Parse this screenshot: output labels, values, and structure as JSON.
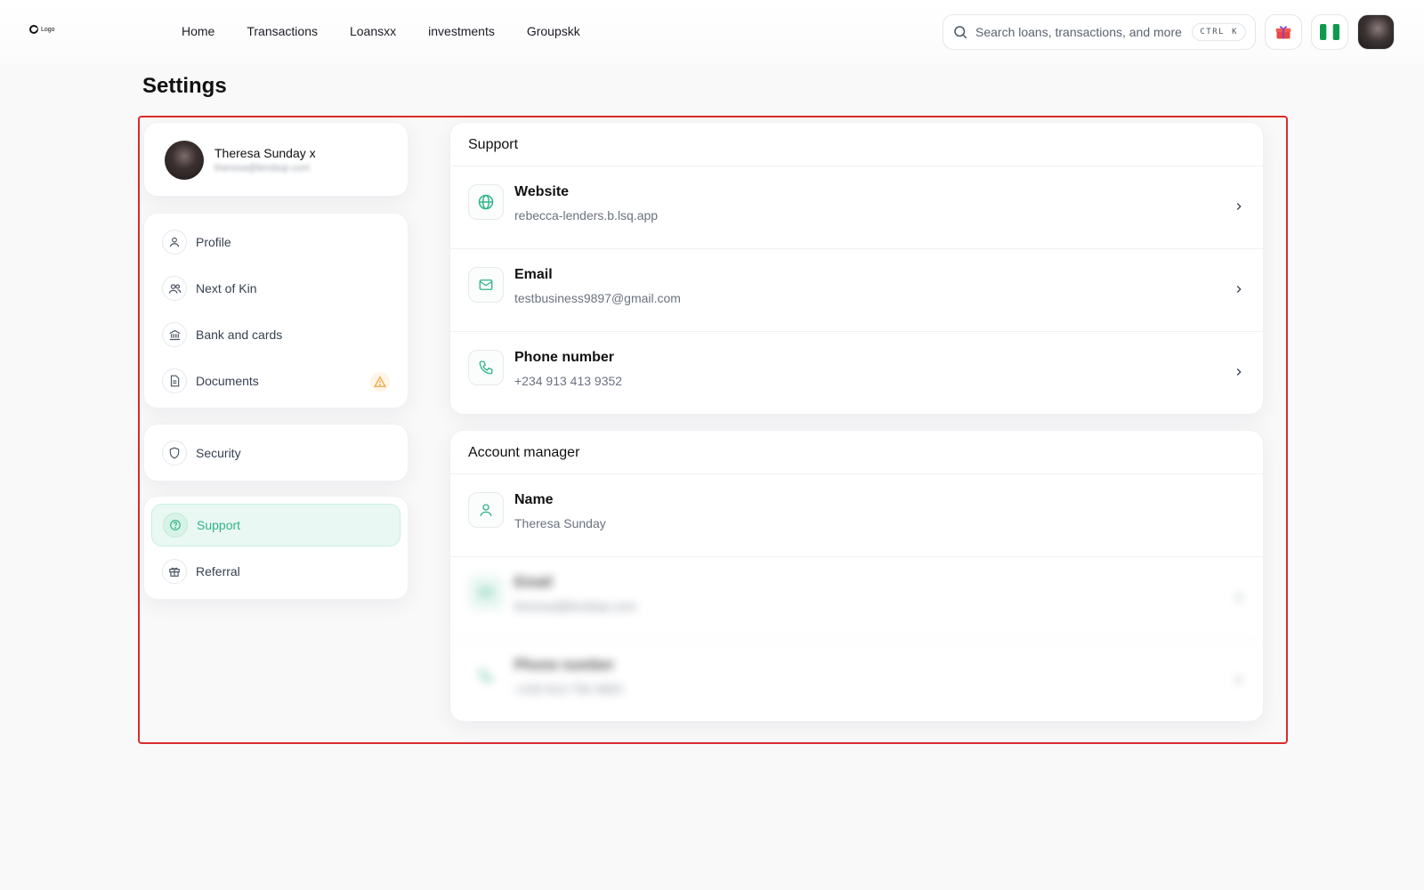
{
  "header": {
    "logo_text": "Logo",
    "nav": [
      "Home",
      "Transactions",
      "Loansxx",
      "investments",
      "Groupskk"
    ],
    "search_placeholder": "Search loans, transactions, and more",
    "shortcut_keys": [
      "CTRL",
      "K"
    ]
  },
  "page_title": "Settings",
  "user": {
    "name": "Theresa Sunday x",
    "email": "theresa@lendsqr.com"
  },
  "menu": {
    "personal": [
      {
        "label": "Profile",
        "icon": "user-icon"
      },
      {
        "label": "Next of Kin",
        "icon": "users-icon"
      },
      {
        "label": "Bank and cards",
        "icon": "bank-icon"
      },
      {
        "label": "Documents",
        "icon": "document-icon"
      }
    ],
    "security": [
      {
        "label": "Security",
        "icon": "shield-icon"
      }
    ],
    "help": [
      {
        "label": "Support",
        "icon": "help-circle-icon",
        "active": true
      },
      {
        "label": "Referral",
        "icon": "gift-icon"
      }
    ]
  },
  "support": {
    "title": "Support",
    "rows": [
      {
        "title": "Website",
        "value": "rebecca-lenders.b.lsq.app",
        "icon": "globe-icon"
      },
      {
        "title": "Email",
        "value": "testbusiness9897@gmail.com",
        "icon": "mail-icon"
      },
      {
        "title": "Phone number",
        "value": "+234 913 413 9352",
        "icon": "phone-icon"
      }
    ]
  },
  "account_manager": {
    "title": "Account manager",
    "rows": [
      {
        "title": "Name",
        "value": "Theresa Sunday",
        "icon": "user-icon"
      },
      {
        "title": "Email",
        "value": "theresa@lendsqr.com",
        "icon": "mail-icon"
      },
      {
        "title": "Phone number",
        "value": "+234 813 756 3663",
        "icon": "phone-icon"
      }
    ]
  },
  "colors": {
    "accent": "#2fb487",
    "highlight_border": "#d92d2d",
    "warning": "#f0a43a"
  }
}
